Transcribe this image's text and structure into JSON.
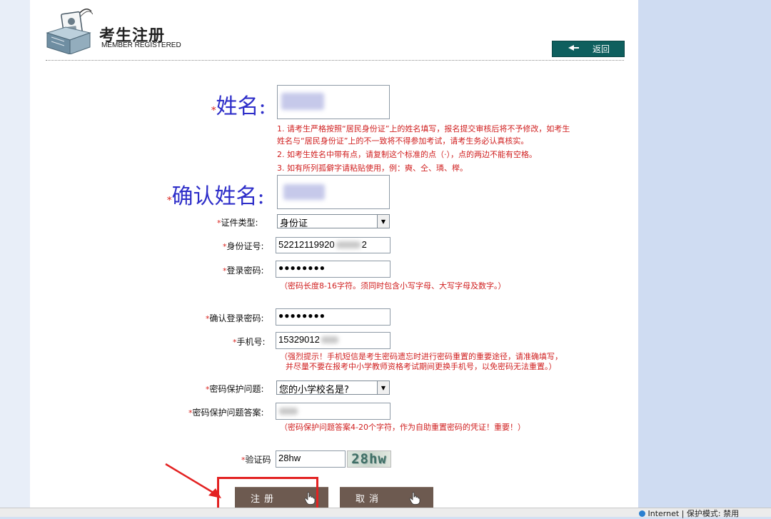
{
  "header": {
    "title_cn": "考生注册",
    "title_en": "MEMBER REGISTERED",
    "back_label": "返回"
  },
  "form": {
    "name": {
      "label": "姓名:",
      "hints": [
        "1. 请考生严格按照“居民身份证”上的姓名填写，报名提交审核后将不予修改，如考生",
        "姓名与“居民身份证”上的不一致将不得参加考试，请考生务必认真核实。",
        "2. 如考生姓名中带有点，请复制这个标准的点（·），点的两边不能有空格。",
        "3. 如有所列孤僻字请粘贴使用，例：奭、仝、璘、榉。"
      ]
    },
    "confirm_name": {
      "label": "确认姓名:"
    },
    "id_type": {
      "label": "证件类型:",
      "value": "身份证"
    },
    "id_number": {
      "label": "身份证号:",
      "value_a": "52212119920",
      "value_b": "2"
    },
    "password": {
      "label": "登录密码:",
      "value": "●●●●●●●●",
      "hint": "（密码长度8-16字符。须同时包含小写字母、大写字母及数字。）"
    },
    "confirm_password": {
      "label": "确认登录密码:",
      "value": "●●●●●●●●"
    },
    "phone": {
      "label": "手机号:",
      "value": "15329012",
      "hint_line1": "（强烈提示！手机短信是考生密码遗忘时进行密码重置的重要途径，请准确填写，",
      "hint_line2": "并尽量不要在报考中小学教师资格考试期间更换手机号，以免密码无法重置。）"
    },
    "security_question": {
      "label": "密码保护问题:",
      "value": "您的小学校名是?"
    },
    "security_answer": {
      "label": "密码保护问题答案:",
      "hint": "（密码保护问题答案4-20个字符，作为自助重置密码的凭证！重要！）"
    },
    "captcha": {
      "label": "验证码",
      "value": "28hw",
      "image_text": "28hw"
    }
  },
  "buttons": {
    "register": "注册",
    "cancel": "取消"
  },
  "status_bar": {
    "text": "Internet | 保护模式: 禁用"
  },
  "colors": {
    "accent_button": "#6d5a50",
    "back_button": "#0e5f5e",
    "hint_red": "#d02020",
    "big_label_blue": "#2e2ec9",
    "highlight": "#e32222"
  }
}
